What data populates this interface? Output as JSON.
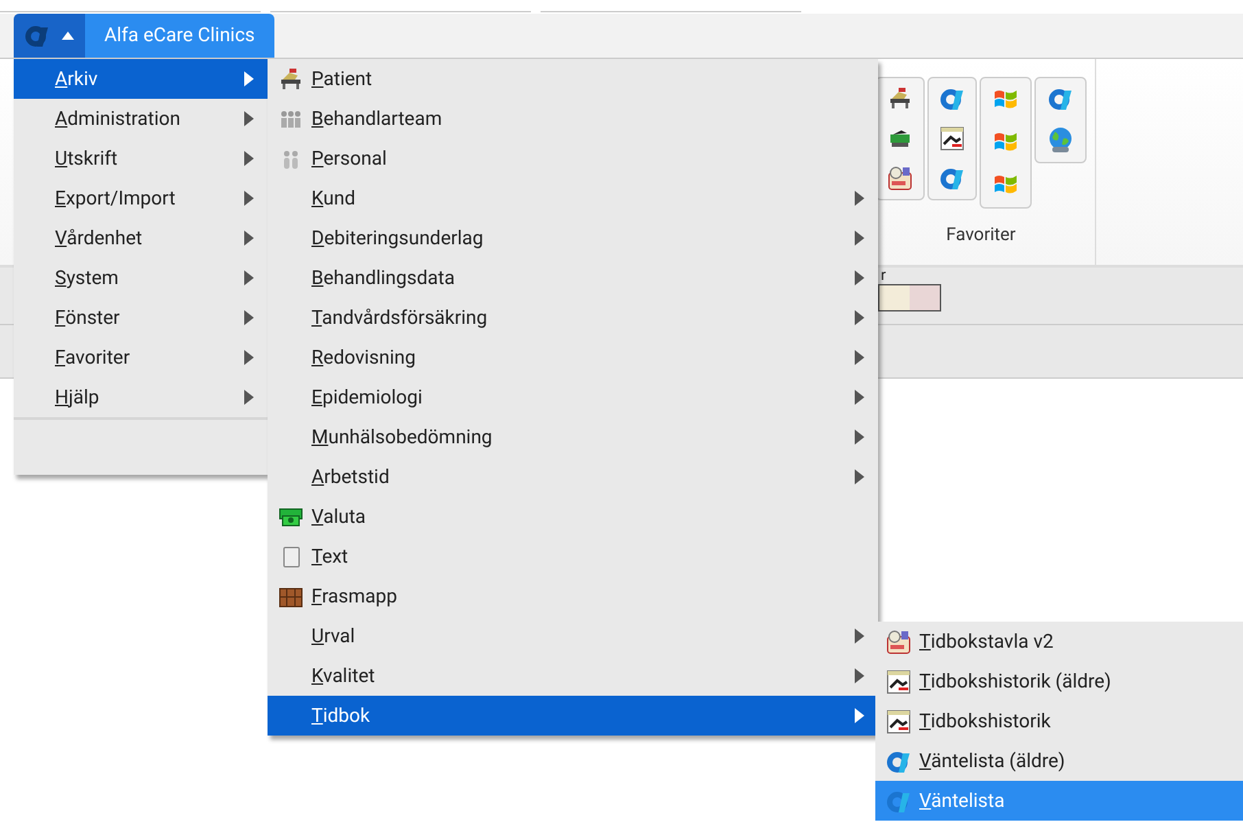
{
  "app_tab": {
    "title": "Alfa eCare Clinics",
    "selected": true
  },
  "ribbon": {
    "group_label": "Favoriter"
  },
  "table": {
    "column_1_fragment": "r"
  },
  "main_menu": [
    {
      "label": "Arkiv",
      "selected": true,
      "submenu": true
    },
    {
      "label": "Administration",
      "selected": false,
      "submenu": true
    },
    {
      "label": "Utskrift",
      "selected": false,
      "submenu": true
    },
    {
      "label": "Export/Import",
      "selected": false,
      "submenu": true
    },
    {
      "label": "Vårdenhet",
      "selected": false,
      "submenu": true
    },
    {
      "label": "System",
      "selected": false,
      "submenu": true
    },
    {
      "label": "Fönster",
      "selected": false,
      "submenu": true
    },
    {
      "label": "Favoriter",
      "selected": false,
      "submenu": true
    },
    {
      "label": "Hjälp",
      "selected": false,
      "submenu": true
    }
  ],
  "arkiv_menu": [
    {
      "label": "Patient",
      "selected": false,
      "submenu": false
    },
    {
      "label": "Behandlarteam",
      "selected": false,
      "submenu": false
    },
    {
      "label": "Personal",
      "selected": false,
      "submenu": false
    },
    {
      "label": "Kund",
      "selected": false,
      "submenu": true
    },
    {
      "label": "Debiteringsunderlag",
      "selected": false,
      "submenu": true
    },
    {
      "label": "Behandlingsdata",
      "selected": false,
      "submenu": true
    },
    {
      "label": "Tandvårdsförsäkring",
      "selected": false,
      "submenu": true
    },
    {
      "label": "Redovisning",
      "selected": false,
      "submenu": true
    },
    {
      "label": "Epidemiologi",
      "selected": false,
      "submenu": true
    },
    {
      "label": "Munhälsobedömning",
      "selected": false,
      "submenu": true
    },
    {
      "label": "Arbetstid",
      "selected": false,
      "submenu": true
    },
    {
      "label": "Valuta",
      "selected": false,
      "submenu": false
    },
    {
      "label": "Text",
      "selected": false,
      "submenu": false
    },
    {
      "label": "Frasmapp",
      "selected": false,
      "submenu": false
    },
    {
      "label": "Urval",
      "selected": false,
      "submenu": true
    },
    {
      "label": "Kvalitet",
      "selected": false,
      "submenu": true
    },
    {
      "label": "Tidbok",
      "selected": true,
      "submenu": true
    }
  ],
  "tidbok_menu": [
    {
      "label": "Tidbokstavla v2",
      "selected": false
    },
    {
      "label": "Tidbokshistorik (äldre)",
      "selected": false
    },
    {
      "label": "Tidbokshistorik",
      "selected": false
    },
    {
      "label": "Väntelista (äldre)",
      "selected": false
    },
    {
      "label": "Väntelista",
      "selected": true
    }
  ]
}
